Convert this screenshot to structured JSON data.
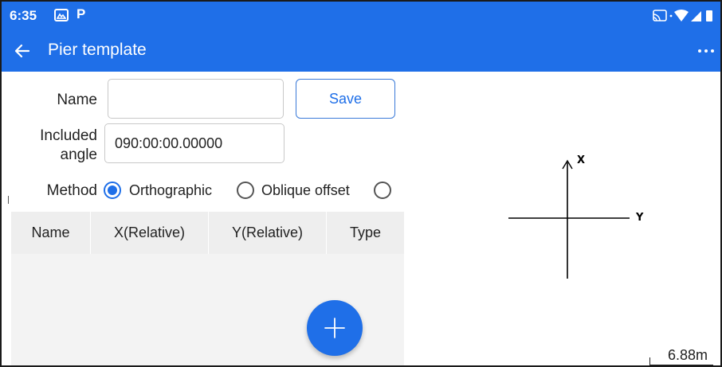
{
  "status_bar": {
    "time": "6:35",
    "notification_icons": [
      "photo-icon",
      "parking-icon"
    ],
    "system_icons": [
      "cast-icon",
      "wifi-icon",
      "signal-icon",
      "battery-icon"
    ]
  },
  "app_bar": {
    "title": "Pier template",
    "back_icon": "arrow-left-icon",
    "menu_icon": "more-horizontal-icon"
  },
  "form": {
    "name_label": "Name",
    "name_value": "",
    "save_label": "Save",
    "angle_label_line1": "Included",
    "angle_label_line2": "angle",
    "angle_value": "090:00:00.00000",
    "method_label": "Method",
    "method_options": [
      {
        "label": "Orthographic",
        "checked": true
      },
      {
        "label": "Oblique offset",
        "checked": false
      },
      {
        "label": "",
        "checked": false
      }
    ]
  },
  "table": {
    "columns": [
      "Name",
      "X(Relative)",
      "Y(Relative)",
      "Type"
    ],
    "rows": []
  },
  "fab": {
    "icon": "plus-icon"
  },
  "diagram": {
    "x_axis_label": "X",
    "y_axis_label": "Y",
    "scale": "6.88m"
  },
  "colors": {
    "primary": "#1f6fe8",
    "table_header": "#eeeeee",
    "table_body": "#f3f3f3"
  }
}
